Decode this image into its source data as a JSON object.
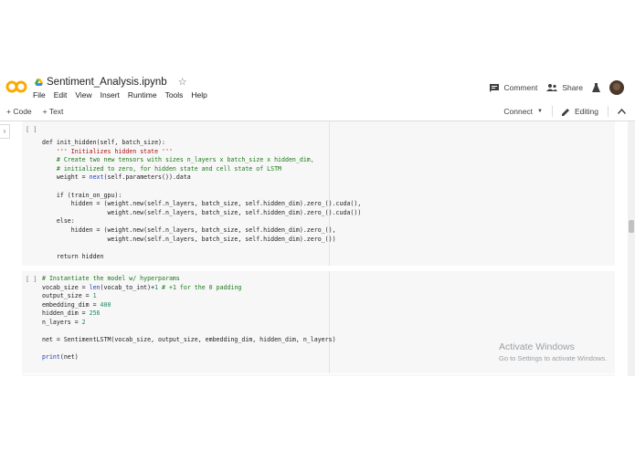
{
  "header": {
    "notebook_title": "Sentiment_Analysis.ipynb",
    "menu": [
      "File",
      "Edit",
      "View",
      "Insert",
      "Runtime",
      "Tools",
      "Help"
    ],
    "comment_label": "Comment",
    "share_label": "Share"
  },
  "toolbar": {
    "add_code_label": "+ Code",
    "add_text_label": "+ Text",
    "connect_label": "Connect",
    "editing_label": "Editing"
  },
  "cells": [
    {
      "bracket": "[ ]",
      "lines": [
        "def init_hidden(self, batch_size):",
        "    ''' Initializes hidden state '''",
        "    # Create two new tensors with sizes n_layers x batch_size x hidden_dim,",
        "    # initialized to zero, for hidden state and cell state of LSTM",
        "    weight = next(self.parameters()).data",
        "",
        "    if (train_on_gpu):",
        "        hidden = (weight.new(self.n_layers, batch_size, self.hidden_dim).zero_().cuda(),",
        "                  weight.new(self.n_layers, batch_size, self.hidden_dim).zero_().cuda())",
        "    else:",
        "        hidden = (weight.new(self.n_layers, batch_size, self.hidden_dim).zero_(),",
        "                  weight.new(self.n_layers, batch_size, self.hidden_dim).zero_())",
        "",
        "    return hidden"
      ]
    },
    {
      "bracket": "[ ]",
      "lines": [
        "# Instantiate the model w/ hyperparams",
        "vocab_size = len(vocab_to_int)+1 # +1 for the 0 padding",
        "output_size = 1",
        "embedding_dim = 400",
        "hidden_dim = 256",
        "n_layers = 2",
        "",
        "net = SentimentLSTM(vocab_size, output_size, embedding_dim, hidden_dim, n_layers)",
        "",
        "print(net)"
      ]
    }
  ],
  "watermark": {
    "line1": "Activate Windows",
    "line2": "Go to Settings to activate Windows."
  },
  "icons": {
    "logo": "colab-logo",
    "drive": "google-drive-icon",
    "star": "star-icon",
    "comment": "comment-icon",
    "share": "share-icon",
    "settings": "flask-icon",
    "edit": "pencil-icon",
    "collapse": "chevron-up-icon"
  },
  "colors": {
    "logo_orange": "#F9AB00",
    "comment_green": "#1b7a1b",
    "number_teal": "#1a8a64",
    "string_red": "#a31515",
    "cell_bg": "#f7f7f7"
  }
}
